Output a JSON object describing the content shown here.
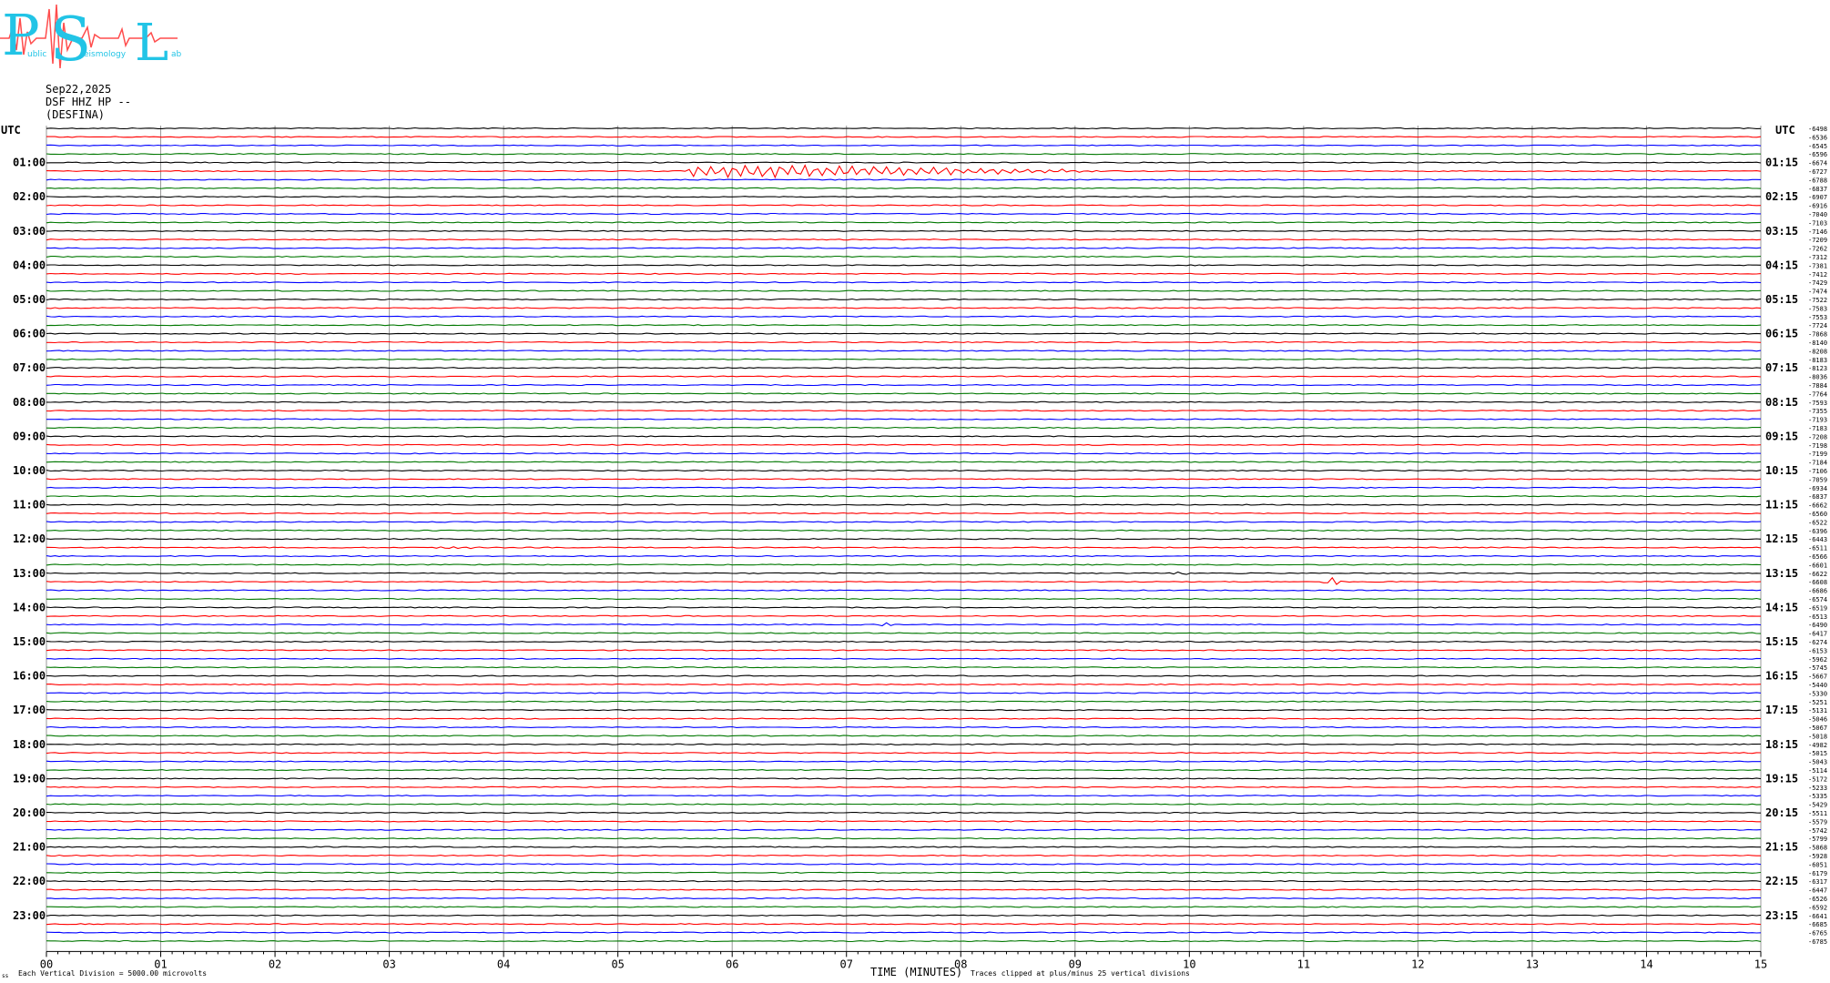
{
  "logo": {
    "letters": [
      "P",
      "S",
      "L"
    ],
    "small_words": [
      "ublic",
      "eismology",
      "ab"
    ]
  },
  "header": {
    "date": "Sep22,2025",
    "station": "DSF HHZ HP --",
    "site": "(DESFINA)"
  },
  "axis_left_unit": "UTC",
  "axis_right_unit": "UTC",
  "footer": {
    "xlabel": "TIME (MINUTES)",
    "left_note": "Each Vertical Division = 5000.00 microvolts",
    "clip_note": "Traces clipped at plus/minus 25 vertical divisions",
    "corner_mark": "ss"
  },
  "colors": {
    "cycle": [
      "#000000",
      "#ff0000",
      "#0000ff",
      "#007700"
    ],
    "grid": "#999999",
    "logo": "#22c4e6",
    "logo_trace": "#ff4d4d"
  },
  "chart_data": {
    "type": "line",
    "title": "",
    "xlabel": "TIME (MINUTES)",
    "ylabel": "",
    "xlim": [
      0,
      15
    ],
    "x_ticks": [
      "00",
      "01",
      "02",
      "03",
      "04",
      "05",
      "06",
      "07",
      "08",
      "09",
      "10",
      "11",
      "12",
      "13",
      "14",
      "15"
    ],
    "rows_per_hour": 4,
    "row_count": 96,
    "left_ticks": [
      "01:00",
      "02:00",
      "03:00",
      "04:00",
      "05:00",
      "06:00",
      "07:00",
      "08:00",
      "09:00",
      "10:00",
      "11:00",
      "12:00",
      "13:00",
      "14:00",
      "15:00",
      "16:00",
      "17:00",
      "18:00",
      "19:00",
      "20:00",
      "21:00",
      "22:00",
      "23:00"
    ],
    "right_ticks": [
      "01:15",
      "02:15",
      "03:15",
      "04:15",
      "05:15",
      "06:15",
      "07:15",
      "08:15",
      "09:15",
      "10:15",
      "11:15",
      "12:15",
      "13:15",
      "14:15",
      "15:15",
      "16:15",
      "17:15",
      "18:15",
      "19:15",
      "20:15",
      "21:15",
      "22:15",
      "23:15"
    ],
    "row_offsets": [
      "-6498",
      "-6536",
      "-6545",
      "-6596",
      "-6674",
      "-6727",
      "-6788",
      "-6837",
      "-6907",
      "-6916",
      "-7040",
      "-7103",
      "-7146",
      "-7209",
      "-7262",
      "-7312",
      "-7381",
      "-7412",
      "-7429",
      "-7474",
      "-7522",
      "-7583",
      "-7553",
      "-7724",
      "-7868",
      "-8140",
      "-8208",
      "-8183",
      "-8123",
      "-8036",
      "-7884",
      "-7764",
      "-7593",
      "-7355",
      "-7193",
      "-7183",
      "-7208",
      "-7198",
      "-7199",
      "-7184",
      "-7106",
      "-7059",
      "-6934",
      "-6837",
      "-6662",
      "-6560",
      "-6522",
      "-6396",
      "-6443",
      "-6511",
      "-6566",
      "-6601",
      "-6622",
      "-6608",
      "-6686",
      "-6574",
      "-6519",
      "-6513",
      "-6490",
      "-6417",
      "-6274",
      "-6153",
      "-5962",
      "-5745",
      "-5667",
      "-5440",
      "-5330",
      "-5251",
      "-5131",
      "-5046",
      "-5067",
      "-5018",
      "-4982",
      "-5015",
      "-5043",
      "-5114",
      "-5172",
      "-5233",
      "-5335",
      "-5429",
      "-5511",
      "-5579",
      "-5742",
      "-5799",
      "-5868",
      "-5928",
      "-6051",
      "-6179",
      "-6317",
      "-6447",
      "-6526",
      "-6592",
      "-6641",
      "-6685",
      "-6765",
      "-6785"
    ],
    "events": [
      {
        "row": 5,
        "x_start": 5.6,
        "x_end": 9.2,
        "amplitude": 8,
        "peak_at": 6.2
      },
      {
        "row": 53,
        "x_start": 11.15,
        "x_end": 11.35,
        "amplitude": 6,
        "peak_at": 11.22
      },
      {
        "row": 52,
        "x_start": 9.85,
        "x_end": 10.0,
        "amplitude": 2,
        "peak_at": 9.92
      },
      {
        "row": 58,
        "x_start": 7.25,
        "x_end": 7.45,
        "amplitude": 3,
        "peak_at": 7.35
      },
      {
        "row": 49,
        "x_start": 3.4,
        "x_end": 3.85,
        "amplitude": 1.5,
        "peak_at": 3.6
      }
    ],
    "grid": true
  }
}
